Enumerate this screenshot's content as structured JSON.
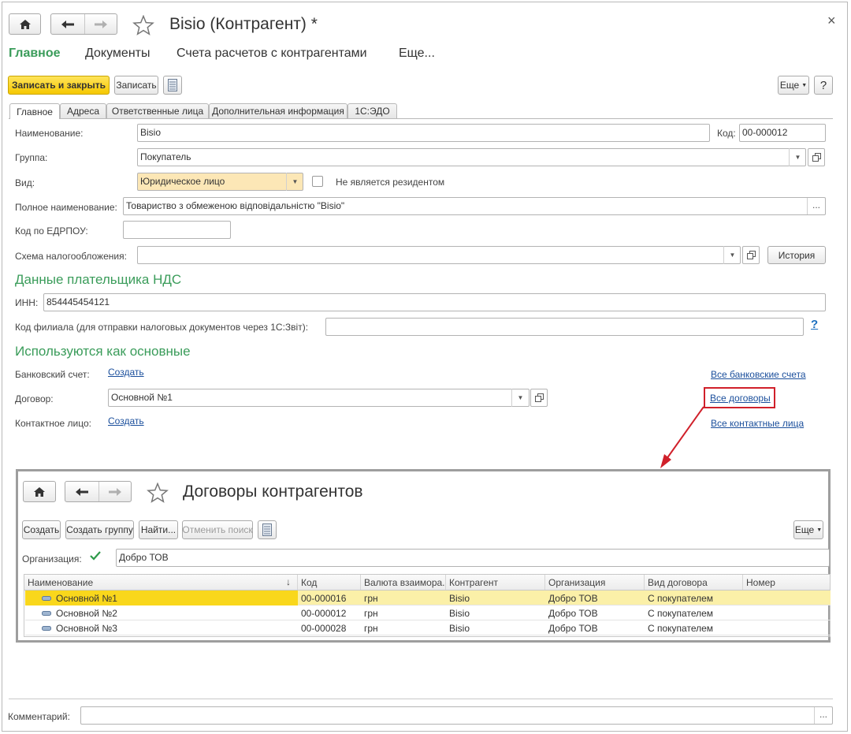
{
  "window": {
    "title": "Bisio (Контрагент) *",
    "close_glyph": "×"
  },
  "menu": {
    "items": [
      {
        "label": "Главное",
        "active": true
      },
      {
        "label": "Документы"
      },
      {
        "label": "Счета расчетов с контрагентами"
      },
      {
        "label": "Еще..."
      }
    ]
  },
  "toolbar": {
    "save_close_label": "Записать и закрыть",
    "save_label": "Записать",
    "more_label": "Еще",
    "help_label": "?"
  },
  "tabs": [
    {
      "label": "Главное",
      "active": true
    },
    {
      "label": "Адреса"
    },
    {
      "label": "Ответственные лица"
    },
    {
      "label": "Дополнительная информация"
    },
    {
      "label": "1С:ЭДО"
    }
  ],
  "form": {
    "name_label": "Наименование:",
    "name_value": "Bisio",
    "code_label": "Код:",
    "code_value": "00-000012",
    "group_label": "Группа:",
    "group_value": "Покупатель",
    "kind_label": "Вид:",
    "kind_value": "Юридическое лицо",
    "nonresident_label": "Не является резидентом",
    "fullname_label": "Полное наименование:",
    "fullname_value": "Товариство з обмеженою відповідальністю \"Bisio\"",
    "edrpou_label": "Код по ЕДРПОУ:",
    "edrpou_value": "",
    "tax_label": "Схема налогообложения:",
    "tax_value": "",
    "history_label": "История",
    "ellipsis": "..."
  },
  "vat_section": {
    "title": "Данные плательщика НДС",
    "inn_label": "ИНН:",
    "inn_value": "854445454121",
    "branch_label": "Код филиала (для отправки налоговых документов через 1С:Звіт):",
    "branch_value": "",
    "help_glyph": "?"
  },
  "defaults_section": {
    "title": "Используются как основные",
    "bank_label": "Банковский счет:",
    "bank_create": "Создать",
    "bank_all": "Все банковские счета",
    "contract_label": "Договор:",
    "contract_value": "Основной №1",
    "contract_all": "Все договоры",
    "contact_label": "Контактное лицо:",
    "contact_create": "Создать",
    "contact_all": "Все контактные лица"
  },
  "comment": {
    "label": "Комментарий:",
    "value": ""
  },
  "contracts_window": {
    "title": "Договоры контрагентов",
    "create_label": "Создать",
    "create_group_label": "Создать группу",
    "find_label": "Найти...",
    "cancel_search_label": "Отменить поиск",
    "more_label": "Еще",
    "org_label": "Организация:",
    "org_value": "Добро ТОВ",
    "columns": [
      "Наименование",
      "Код",
      "Валюта взаимора...",
      "Контрагент",
      "Организация",
      "Вид договора",
      "Номер"
    ],
    "sort_glyph": "↓",
    "rows": [
      [
        "Основной №1",
        "00-000016",
        "грн",
        "Bisio",
        "Добро ТОВ",
        "С покупателем",
        ""
      ],
      [
        "Основной №2",
        "00-000012",
        "грн",
        "Bisio",
        "Добро ТОВ",
        "С покупателем",
        ""
      ],
      [
        "Основной №3",
        "00-000028",
        "грн",
        "Bisio",
        "Добро ТОВ",
        "С покупателем",
        ""
      ]
    ]
  },
  "colors": {
    "accent_green": "#3a9c5a",
    "highlight_yellow": "#f9d71c",
    "callout_red": "#d0202a"
  }
}
